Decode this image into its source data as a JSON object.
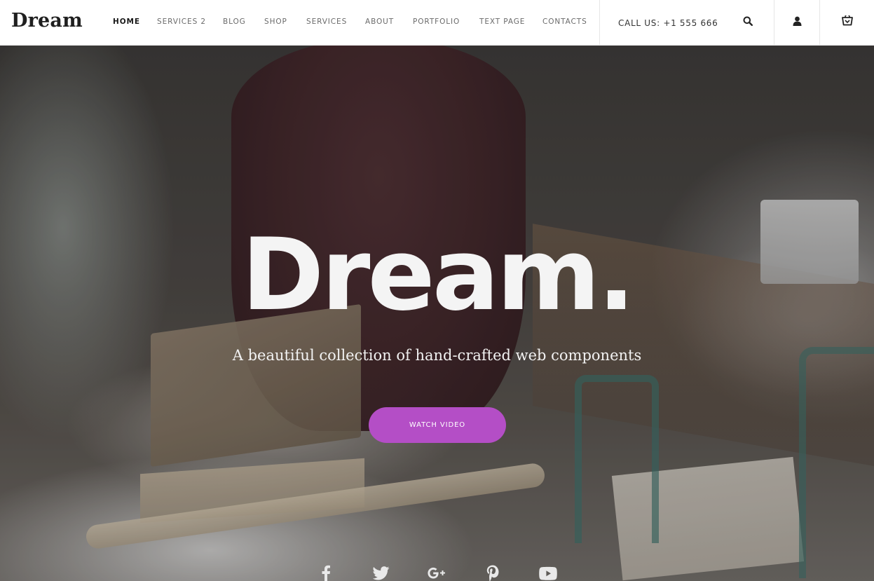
{
  "brand": {
    "logo_text": "Dream"
  },
  "nav": {
    "items": [
      {
        "label": "HOME",
        "active": true
      },
      {
        "label": "SERVICES 2",
        "active": false
      },
      {
        "label": "BLOG",
        "active": false
      },
      {
        "label": "SHOP",
        "active": false
      },
      {
        "label": "SERVICES",
        "active": false
      },
      {
        "label": "ABOUT",
        "active": false
      },
      {
        "label": "PORTFOLIO",
        "active": false
      },
      {
        "label": "TEXT PAGE",
        "active": false
      },
      {
        "label": "CONTACTS",
        "active": false
      }
    ]
  },
  "header": {
    "call_text": "CALL US: +1 555 666",
    "icons": [
      "search-icon",
      "user-icon",
      "cart-icon"
    ]
  },
  "hero": {
    "title": "Dream.",
    "subtitle": "A beautiful collection of hand-crafted web components",
    "button_label": "WATCH VIDEO",
    "button_color": "#b44ec6"
  },
  "social": {
    "icons": [
      "facebook-icon",
      "twitter-icon",
      "google-plus-icon",
      "pinterest-icon",
      "youtube-icon"
    ]
  }
}
